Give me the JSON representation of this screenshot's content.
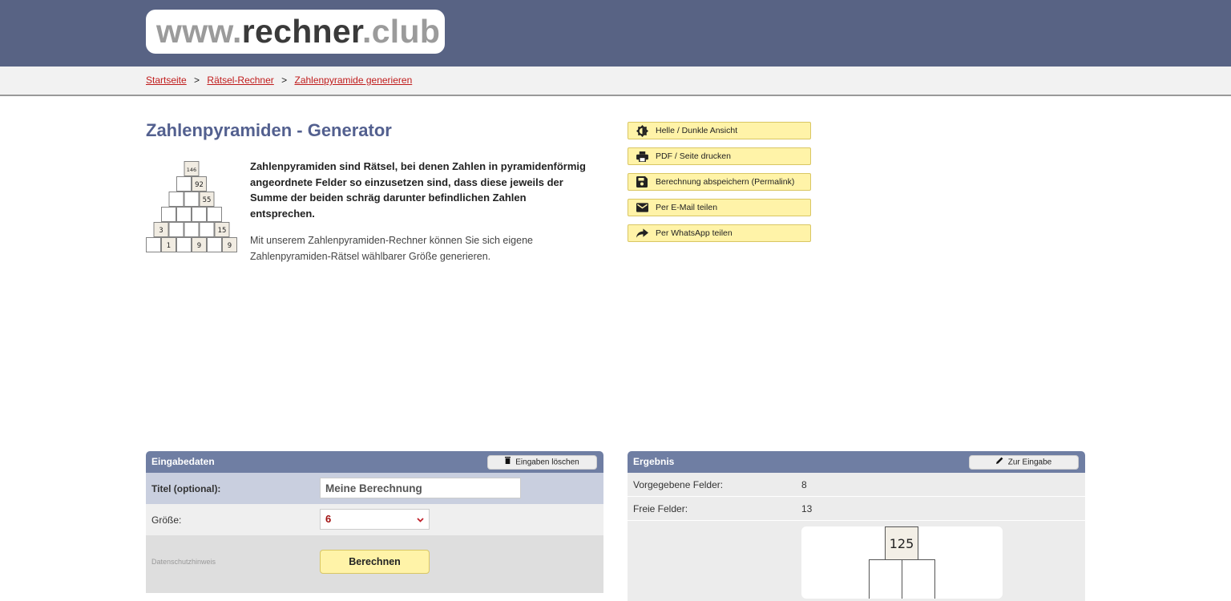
{
  "brand": {
    "www": "www.",
    "name": "rechner",
    "tld": ".club"
  },
  "breadcrumb": [
    {
      "label": "Startseite"
    },
    {
      "label": "Rätsel-Rechner"
    },
    {
      "label": "Zahlenpyramide generieren"
    }
  ],
  "breadcrumb_sep": ">",
  "page": {
    "title": "Zahlenpyramiden - Generator",
    "intro_bold": "Zahlenpyramiden sind Rätsel, bei denen Zahlen in pyramidenförmig angeordnete Felder so einzusetzen sind, dass diese jeweils der Summe der beiden schräg darunter befindlichen Zahlen entsprechen.",
    "intro": "Mit unserem Zahlenpyramiden-Rechner können Sie sich eigene Zahlenpyramiden-Rätsel wählbarer Größe generieren."
  },
  "example_pyramid": {
    "rows": [
      [
        "146"
      ],
      [
        "",
        "92"
      ],
      [
        "",
        "",
        "55"
      ],
      [
        "",
        "",
        "",
        ""
      ],
      [
        "3",
        "",
        "",
        "",
        "15"
      ],
      [
        "",
        "1",
        "",
        "9",
        "",
        "9"
      ]
    ]
  },
  "actions": [
    {
      "label": "Helle / Dunkle Ansicht",
      "icon": "contrast-icon"
    },
    {
      "label": "PDF / Seite drucken",
      "icon": "print-icon"
    },
    {
      "label": "Berechnung abspeichern (Permalink)",
      "icon": "save-icon"
    },
    {
      "label": "Per E-Mail teilen",
      "icon": "mail-icon"
    },
    {
      "label": "Per WhatsApp teilen",
      "icon": "share-icon"
    }
  ],
  "input_panel": {
    "title": "Eingabedaten",
    "clear_label": "Eingaben löschen",
    "title_field_label": "Titel (optional):",
    "title_field_value": "Meine Berechnung",
    "size_label": "Größe:",
    "size_value": "6",
    "privacy_label": "Datenschutzhinweis",
    "calc_label": "Berechnen"
  },
  "result_panel": {
    "title": "Ergebnis",
    "back_label": "Zur Eingabe",
    "given_label": "Vorgegebene Felder:",
    "given_value": "8",
    "free_label": "Freie Felder:",
    "free_value": "13",
    "top_value": "125"
  },
  "colors": {
    "header": "#586384",
    "panel_head": "#6f7ea3",
    "button_yellow": "#fff3a8",
    "link_red": "#c01b1b",
    "title_blue": "#53608f"
  }
}
